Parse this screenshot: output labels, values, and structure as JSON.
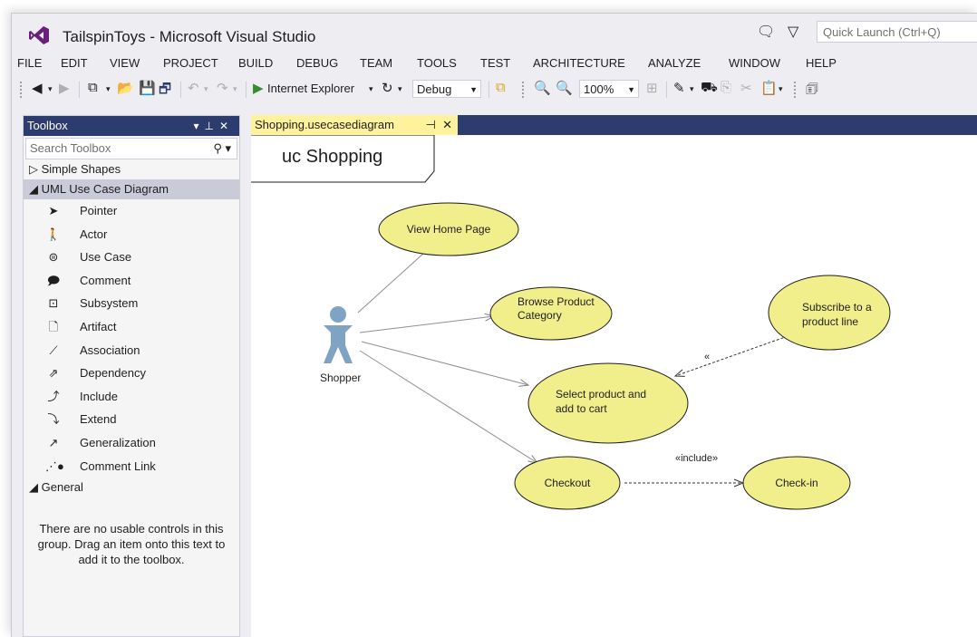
{
  "window": {
    "title": "TailspinToys - Microsoft Visual Studio",
    "quick_launch_placeholder": "Quick Launch (Ctrl+Q)"
  },
  "menu": [
    "FILE",
    "EDIT",
    "VIEW",
    "PROJECT",
    "BUILD",
    "DEBUG",
    "TEAM",
    "TOOLS",
    "TEST",
    "ARCHITECTURE",
    "ANALYZE",
    "WINDOW",
    "HELP"
  ],
  "toolbar": {
    "run_target": "Internet Explorer",
    "configuration": "Debug",
    "zoom": "100%"
  },
  "toolbox": {
    "title": "Toolbox",
    "search_placeholder": "Search Toolbox",
    "groups": {
      "simple_shapes": "Simple Shapes",
      "uml_use_case": "UML Use Case Diagram",
      "general": "General"
    },
    "items": [
      {
        "label": "Pointer",
        "icon": "pointer-icon"
      },
      {
        "label": "Actor",
        "icon": "actor-icon"
      },
      {
        "label": "Use Case",
        "icon": "use-case-icon"
      },
      {
        "label": "Comment",
        "icon": "comment-icon"
      },
      {
        "label": "Subsystem",
        "icon": "subsystem-icon"
      },
      {
        "label": "Artifact",
        "icon": "artifact-icon"
      },
      {
        "label": "Association",
        "icon": "association-icon"
      },
      {
        "label": "Dependency",
        "icon": "dependency-icon"
      },
      {
        "label": "Include",
        "icon": "include-icon"
      },
      {
        "label": "Extend",
        "icon": "extend-icon"
      },
      {
        "label": "Generalization",
        "icon": "generalization-icon"
      },
      {
        "label": "Comment Link",
        "icon": "comment-link-icon"
      }
    ],
    "general_empty_text": "There are no usable controls in this group. Drag an item onto this text to add it to the toolbox."
  },
  "document": {
    "tab_label": "Shopping.usecasediagram",
    "diagram_header": "uc Shopping"
  },
  "diagram": {
    "actor": "Shopper",
    "use_cases": {
      "view_home": "View Home Page",
      "browse_1": "Browse Product",
      "browse_2": "Category",
      "subscribe_1": "Subscribe to a",
      "subscribe_2": "product line",
      "select_1": "Select product and",
      "select_2": "add to cart",
      "checkout": "Checkout",
      "checkin": "Check-in"
    },
    "extend_label": "«",
    "include_label": "«include»",
    "colors": {
      "use_case_fill": "#f0ef8c",
      "actor_fill": "#7fa3c2",
      "accent_tab": "#fff29d",
      "header_blue": "#2d3c6e"
    }
  }
}
